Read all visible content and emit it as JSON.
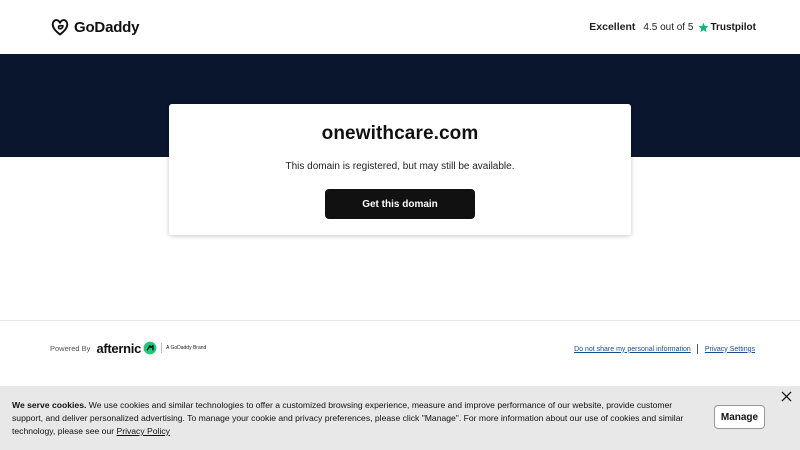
{
  "header": {
    "logo_text": "GoDaddy",
    "trustpilot": {
      "label": "Excellent",
      "rating": "4.5 out of 5",
      "brand": "Trustpilot",
      "star_color": "#00b67a"
    }
  },
  "card": {
    "domain": "onewithcare.com",
    "message": "This domain is registered, but may still be available.",
    "button_label": "Get this domain"
  },
  "footer": {
    "powered_by": "Powered By",
    "afternic": "afternic",
    "godaddy_brand": "A GoDaddy Brand",
    "links": [
      {
        "label": "Do not share my personal information"
      },
      {
        "label": "Privacy Settings"
      }
    ]
  },
  "cookie": {
    "lead": "We serve cookies.",
    "body": " We use cookies and similar technologies to offer a customized browsing experience, measure and improve performance of our website, provide customer support, and deliver personalized advertising. To manage your cookie and privacy preferences, please click \"Manage\". For more information about our use of cookies and similar technology, please see our ",
    "policy_link": "Privacy Policy",
    "manage_label": "Manage"
  },
  "colors": {
    "band": "#09162e",
    "button": "#111111",
    "afternic_green": "#1ec97c"
  }
}
